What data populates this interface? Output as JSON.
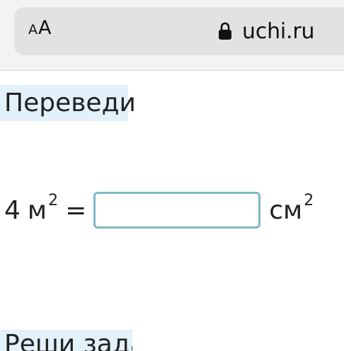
{
  "browser": {
    "reader_small": "A",
    "reader_large": "A",
    "url": "uchi.ru",
    "lock_icon": "lock-icon"
  },
  "task": {
    "heading": "Переведи",
    "number": "4",
    "unit_from": "м",
    "unit_from_power": "2",
    "equals": "=",
    "answer_value": "",
    "unit_to": "см",
    "unit_to_power": "2"
  },
  "next_task": {
    "heading": "Реши задачи"
  }
}
